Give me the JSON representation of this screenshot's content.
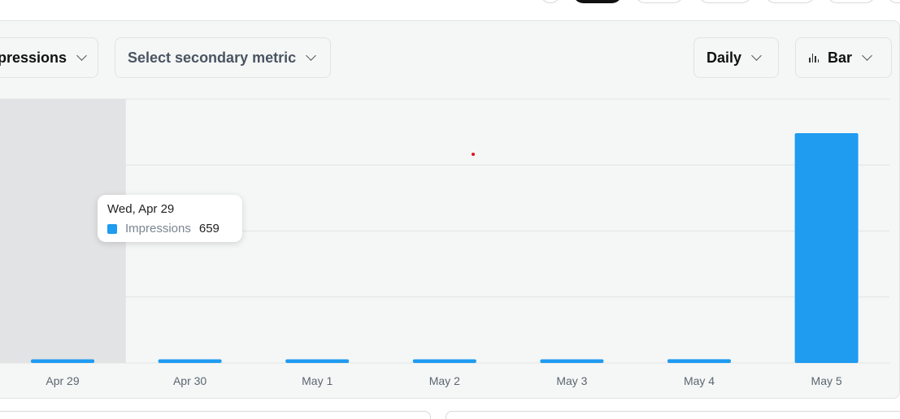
{
  "controls": {
    "primary_metric": "Impressions",
    "secondary_metric_placeholder": "Select secondary metric",
    "interval": "Daily",
    "chart_type": "Bar"
  },
  "tooltip": {
    "date": "Wed, Apr 29",
    "series": "Impressions",
    "value": "659"
  },
  "colors": {
    "bar": "#1f9bf0",
    "hover_band": "#e2e3e5",
    "grid": "#e1e4e3",
    "marker": "#e0141e"
  },
  "chart_data": {
    "type": "bar",
    "categories": [
      "Apr 29",
      "Apr 30",
      "May 1",
      "May 2",
      "May 3",
      "May 4",
      "May 5"
    ],
    "series": [
      {
        "name": "Impressions",
        "values": [
          659,
          1050,
          1100,
          1050,
          900,
          1200,
          74000
        ]
      }
    ],
    "ylim": [
      0,
      85000
    ],
    "grid": true,
    "highlighted_category": "Apr 29"
  }
}
